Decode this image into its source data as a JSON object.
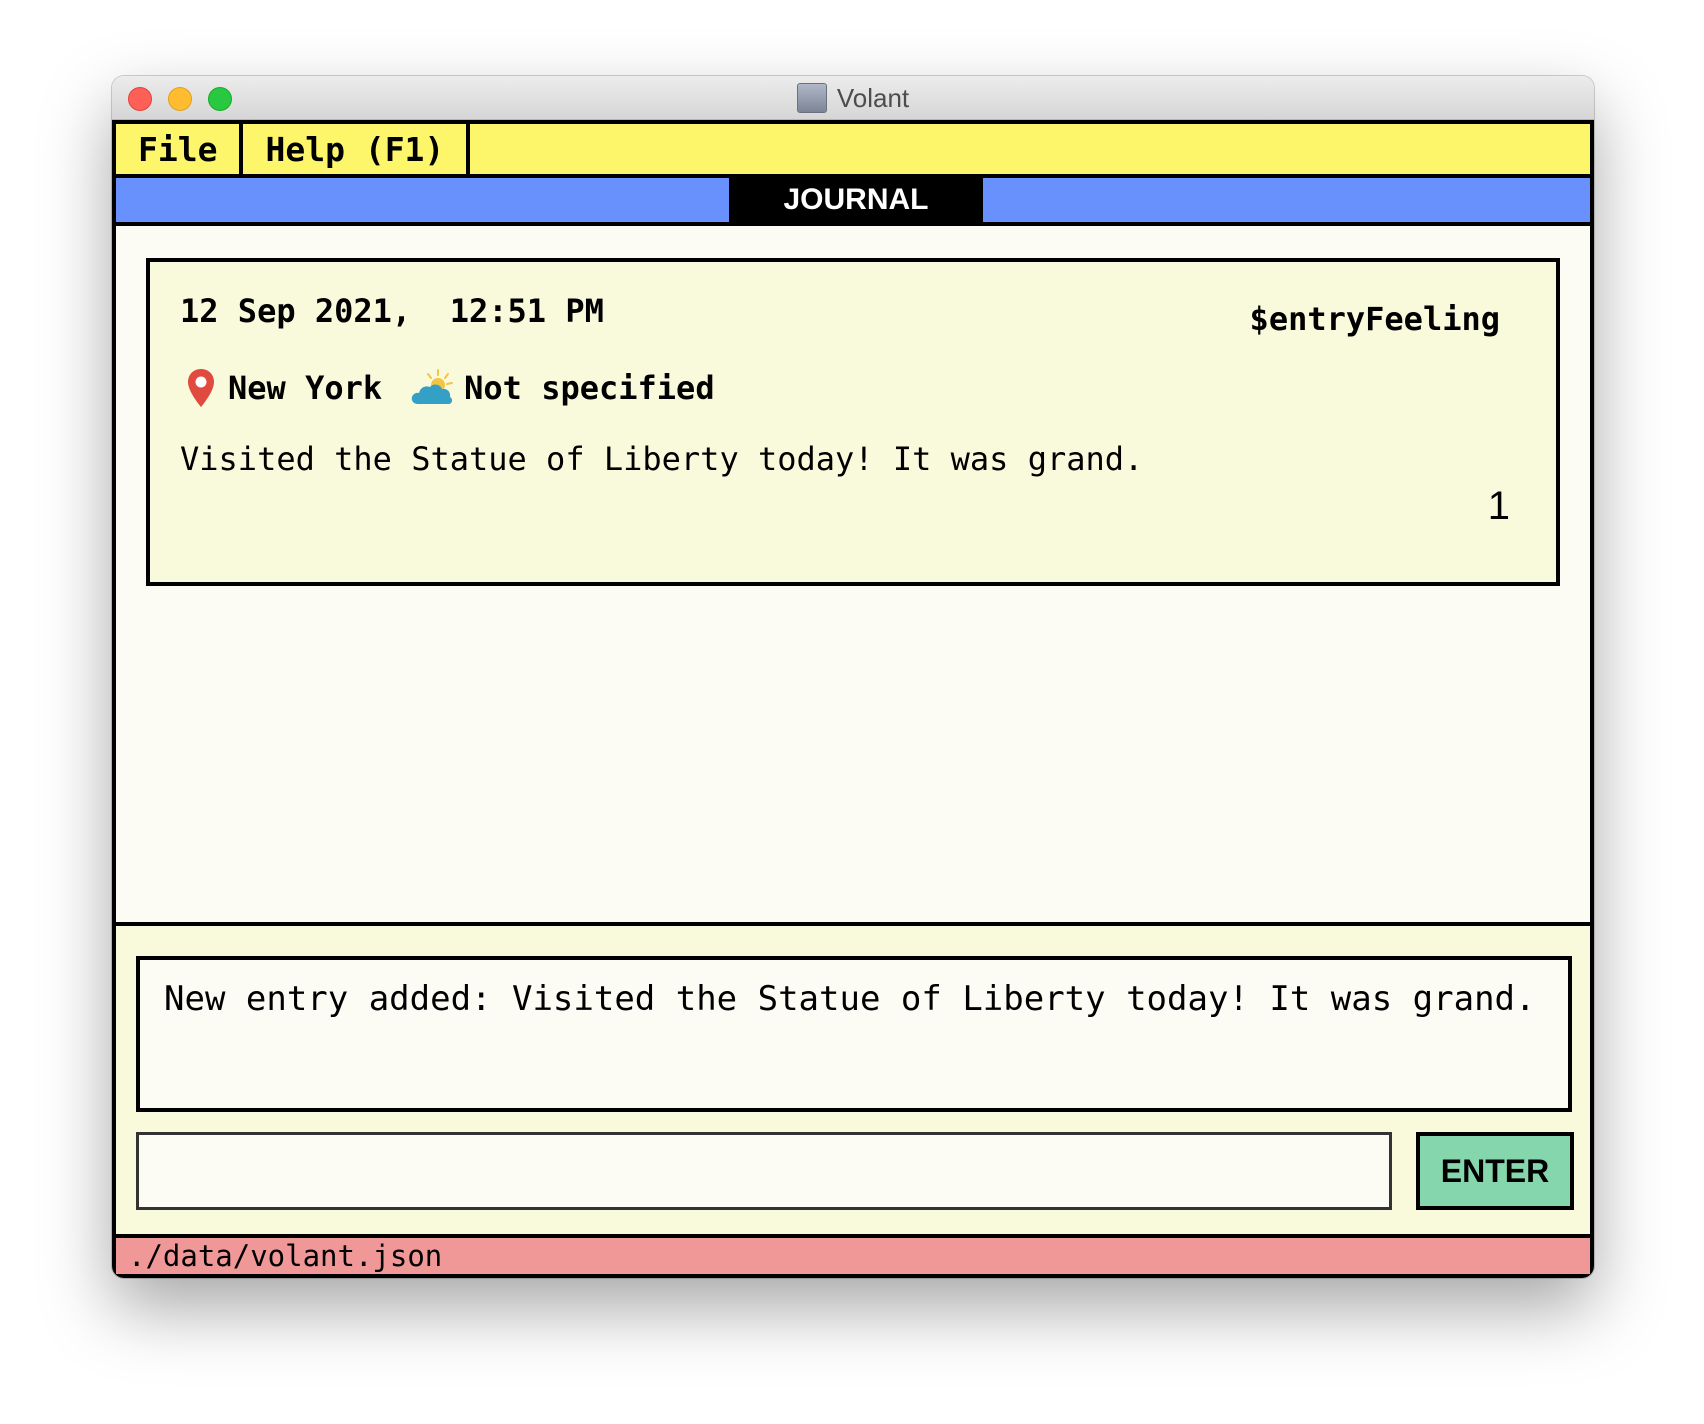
{
  "window": {
    "title": "Volant"
  },
  "menu": {
    "file": "File",
    "help": "Help (F1)"
  },
  "tabs": {
    "active": "JOURNAL"
  },
  "entry": {
    "date": "12 Sep 2021,  12:51 PM",
    "feeling": "$entryFeeling",
    "location": "New York",
    "weather": "Not specified",
    "text": "Visited the Statue of Liberty today! It was grand.",
    "index": "1"
  },
  "result": {
    "message": "New entry added: Visited the Statue of Liberty today! It was grand."
  },
  "command": {
    "value": "",
    "placeholder": ""
  },
  "button": {
    "enter": "ENTER"
  },
  "status": {
    "path": "./data/volant.json"
  },
  "icons": {
    "location": "map-pin-icon",
    "weather": "partly-cloudy-icon"
  },
  "colors": {
    "menubar": "#fdf66a",
    "tabbar": "#6891fd",
    "card": "#f9f9dc",
    "enter_button": "#85d6ac",
    "statusbar": "#f09797"
  }
}
